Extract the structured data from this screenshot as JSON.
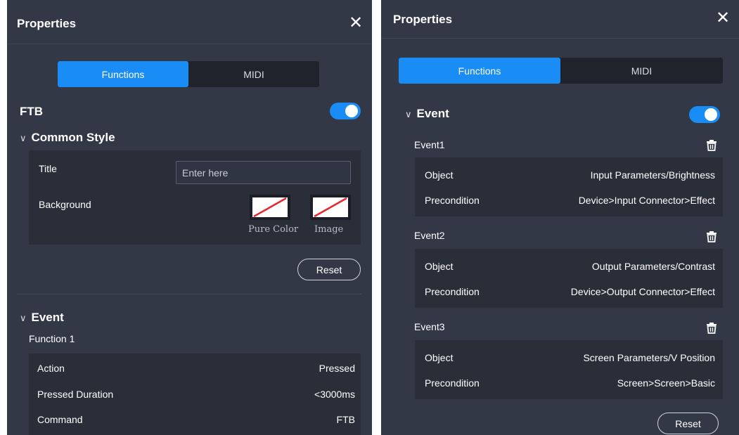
{
  "colors": {
    "panel": "#323846",
    "box": "#292e39",
    "accent": "#1a8cf6",
    "segment_bg": "#1f232c"
  },
  "left": {
    "header": {
      "title": "Properties",
      "close_icon": "close-icon"
    },
    "tabs": [
      {
        "label": "Functions",
        "active": true
      },
      {
        "label": "MIDI",
        "active": false
      }
    ],
    "ftb": {
      "label": "FTB",
      "enabled": true
    },
    "common_style": {
      "heading": "Common Style",
      "title_label": "Title",
      "title_placeholder": "Enter here",
      "title_value": "",
      "background_label": "Background",
      "pure_color_label": "Pure Color",
      "image_label": "Image"
    },
    "reset_label": "Reset",
    "event": {
      "heading": "Event",
      "function_title": "Function 1",
      "rows": [
        {
          "label": "Action",
          "value": "Pressed"
        },
        {
          "label": "Pressed Duration",
          "value": "<3000ms"
        },
        {
          "label": "Command",
          "value": "FTB"
        }
      ]
    }
  },
  "right": {
    "header": {
      "title": "Properties",
      "close_icon": "close-icon"
    },
    "tabs": [
      {
        "label": "Functions",
        "active": true
      },
      {
        "label": "MIDI",
        "active": false
      }
    ],
    "event": {
      "heading": "Event",
      "enabled": true,
      "events": [
        {
          "name": "Event1",
          "object_label": "Object",
          "object_value": "Input Parameters/Brightness",
          "precondition_label": "Precondition",
          "precondition_value": "Device>Input Connector>Effect"
        },
        {
          "name": "Event2",
          "object_label": "Object",
          "object_value": "Output Parameters/Contrast",
          "precondition_label": "Precondition",
          "precondition_value": "Device>Output Connector>Effect"
        },
        {
          "name": "Event3",
          "object_label": "Object",
          "object_value": "Screen Parameters/V Position",
          "precondition_label": "Precondition",
          "precondition_value": "Screen>Screen>Basic"
        }
      ]
    },
    "reset_label": "Reset"
  }
}
